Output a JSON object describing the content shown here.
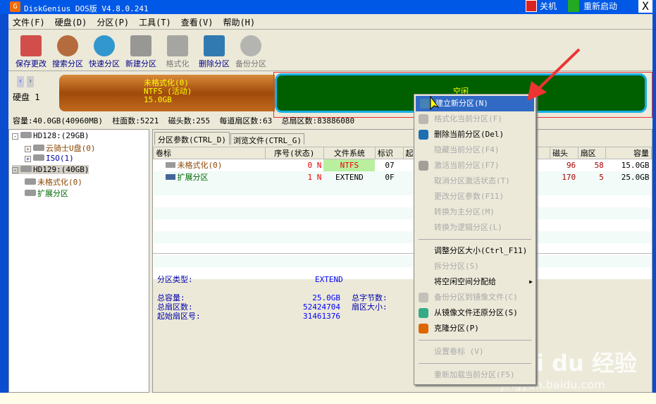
{
  "title": "DiskGenius DOS版 V4.8.0.241",
  "title_buttons": {
    "shutdown": "关机",
    "restart": "重新启动",
    "close": "X"
  },
  "menu": [
    "文件(F)",
    "硬盘(D)",
    "分区(P)",
    "工具(T)",
    "查看(V)",
    "帮助(H)"
  ],
  "toolbar": [
    {
      "label": "保存更改",
      "icon": "save-icon",
      "enabled": true
    },
    {
      "label": "搜索分区",
      "icon": "search-icon",
      "enabled": true
    },
    {
      "label": "快速分区",
      "icon": "quick-partition-icon",
      "enabled": true
    },
    {
      "label": "新建分区",
      "icon": "new-partition-icon",
      "enabled": true
    },
    {
      "label": "格式化",
      "icon": "format-icon",
      "enabled": false
    },
    {
      "label": "删除分区",
      "icon": "delete-icon",
      "enabled": true
    },
    {
      "label": "备份分区",
      "icon": "backup-icon",
      "enabled": false
    }
  ],
  "diskbar": {
    "disk_label": "硬盘 1",
    "part1": {
      "name": "未格式化(0)",
      "fs": "NTFS (活动)",
      "size": "15.0GB"
    },
    "free_label": "空闲"
  },
  "disk_info": {
    "capacity": "容量:40.0GB(40960MB)",
    "cylinders": "柱面数:5221",
    "heads": "磁头数:255",
    "sectors_per_track": "每道扇区数:63",
    "total_sectors": "总扇区数:83886080"
  },
  "tree": [
    {
      "label": "HD128:(29GB)"
    },
    {
      "label": "云骑士U盘(0)"
    },
    {
      "label": "ISO(1)"
    },
    {
      "label": "HD129:(40GB)"
    },
    {
      "label": "未格式化(0)"
    },
    {
      "label": "扩展分区"
    }
  ],
  "tabs": [
    "分区参数(CTRL_D)",
    "浏览文件(CTRL_G)"
  ],
  "table": {
    "headers": [
      "卷标",
      "序号(状态)",
      "文件系统",
      "标识",
      "起始",
      "磁头",
      "扇区",
      "容量"
    ],
    "rows": [
      {
        "label": "未格式化(0)",
        "num": "0",
        "state": "N",
        "fs": "NTFS",
        "id": "07",
        "head": "96",
        "sector": "58",
        "size": "15.0GB"
      },
      {
        "label": "扩展分区",
        "num": "1",
        "state": "N",
        "fs": "EXTEND",
        "id": "0F",
        "head": "170",
        "sector": "5",
        "size": "25.0GB"
      }
    ]
  },
  "details": {
    "type_label": "分区类型:",
    "type_value": "EXTEND",
    "cap_label": "总容量:",
    "cap_value": "25.0GB",
    "sectors_label": "总扇区数:",
    "sectors_value": "52424704",
    "start_label": "起始扇区号:",
    "start_value": "31461376",
    "bytes_label": "总字节数:",
    "sector_size_label": "扇区大小:"
  },
  "context_menu": [
    {
      "label": "建立新分区(N)",
      "enabled": true,
      "icon": "new-partition-icon",
      "highlight": true
    },
    {
      "label": "格式化当前分区(F)",
      "enabled": false,
      "icon": "format-icon"
    },
    {
      "label": "删除当前分区(Del)",
      "enabled": true,
      "icon": "delete-icon"
    },
    {
      "label": "隐藏当前分区(F4)",
      "enabled": false
    },
    {
      "label": "激活当前分区(F7)",
      "enabled": false,
      "icon": "plug-icon"
    },
    {
      "label": "取消分区激活状态(T)",
      "enabled": false
    },
    {
      "label": "更改分区参数(F11)",
      "enabled": false
    },
    {
      "label": "转换为主分区(M)",
      "enabled": false
    },
    {
      "label": "转换为逻辑分区(L)",
      "enabled": false,
      "sep_after": true
    },
    {
      "label": "调整分区大小(Ctrl_F11)",
      "enabled": true
    },
    {
      "label": "拆分分区(S)",
      "enabled": false
    },
    {
      "label": "将空闲空间分配给",
      "enabled": true,
      "submenu": true
    },
    {
      "label": "备份分区到镜像文件(C)",
      "enabled": false,
      "icon": "backup-icon"
    },
    {
      "label": "从镜像文件还原分区(S)",
      "enabled": true,
      "icon": "restore-icon"
    },
    {
      "label": "克隆分区(P)",
      "enabled": true,
      "icon": "clone-icon",
      "sep_after": true
    },
    {
      "label": "设置卷标 (V)",
      "enabled": false,
      "sep_after": true
    },
    {
      "label": "重新加载当前分区(F5)",
      "enabled": false
    }
  ],
  "watermark": {
    "brand": "Bai du 经验",
    "url": "jingyan.baidu.com"
  }
}
